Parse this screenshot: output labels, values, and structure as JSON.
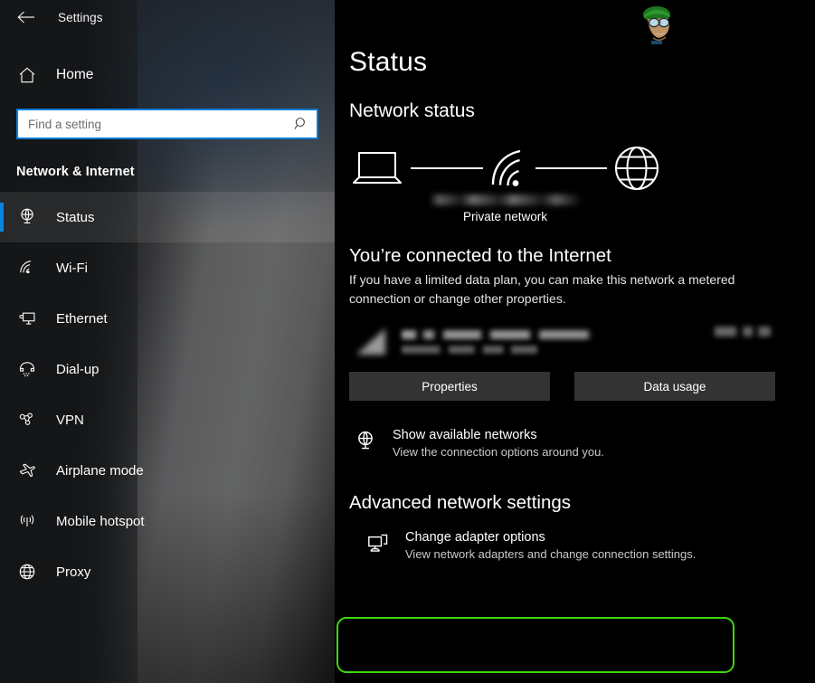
{
  "window": {
    "app_title": "Settings",
    "back_icon": "back-arrow-icon"
  },
  "sidebar": {
    "home": {
      "label": "Home",
      "icon": "home-icon"
    },
    "search": {
      "placeholder": "Find a setting",
      "value": "",
      "icon": "search-icon"
    },
    "category": "Network & Internet",
    "items": [
      {
        "label": "Status",
        "icon": "network-status-icon",
        "selected": true
      },
      {
        "label": "Wi-Fi",
        "icon": "wifi-icon",
        "selected": false
      },
      {
        "label": "Ethernet",
        "icon": "ethernet-icon",
        "selected": false
      },
      {
        "label": "Dial-up",
        "icon": "dial-up-icon",
        "selected": false
      },
      {
        "label": "VPN",
        "icon": "vpn-icon",
        "selected": false
      },
      {
        "label": "Airplane mode",
        "icon": "airplane-icon",
        "selected": false
      },
      {
        "label": "Mobile hotspot",
        "icon": "hotspot-icon",
        "selected": false
      },
      {
        "label": "Proxy",
        "icon": "globe-icon",
        "selected": false
      }
    ]
  },
  "main": {
    "page_title": "Status",
    "network_status_heading": "Network status",
    "diagram": {
      "device_icon": "laptop-icon",
      "connection_icon": "wifi-icon",
      "internet_icon": "globe-icon",
      "network_name": "",
      "network_type": "Private network"
    },
    "connected": {
      "heading": "You’re connected to the Internet",
      "description": "If you have a limited data plan, you can make this network a metered connection or change other properties."
    },
    "network_entry": {
      "icon": "wifi-signal-icon",
      "name": "",
      "period": "",
      "usage": ""
    },
    "buttons": [
      {
        "label": "Properties"
      },
      {
        "label": "Data usage"
      }
    ],
    "show_networks": {
      "icon": "network-status-icon",
      "title": "Show available networks",
      "description": "View the connection options around you."
    },
    "advanced_heading": "Advanced network settings",
    "adapter_options": {
      "icon": "adapter-icon",
      "title": "Change adapter options",
      "description": "View network adapters and change connection settings."
    }
  },
  "annotation": {
    "highlight_color": "#3ed80f",
    "target": "change-adapter-options"
  },
  "colors": {
    "accent": "#0a84e0",
    "search_border": "#0a7bd4",
    "button_bg": "#333333",
    "main_bg": "#000000"
  }
}
